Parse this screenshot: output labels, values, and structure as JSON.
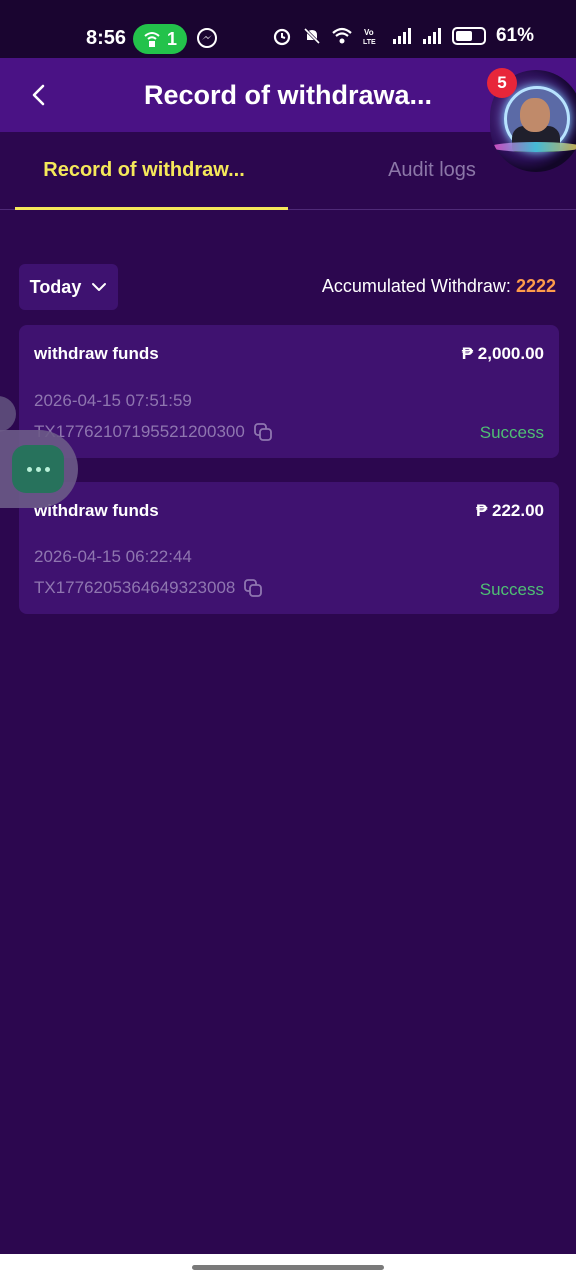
{
  "status_bar": {
    "time": "8:56",
    "hotspot_count": "1",
    "battery": "61%",
    "icons": [
      "alarm-icon",
      "mute-icon",
      "wifi-icon",
      "volte-icon",
      "signal-icon",
      "signal-icon",
      "battery-icon"
    ]
  },
  "header": {
    "title": "Record of withdrawa...",
    "back_icon": "chevron-left-icon"
  },
  "floating_avatar": {
    "badge": "5"
  },
  "tabs": [
    {
      "label": "Record of withdraw...",
      "active": true
    },
    {
      "label": "Audit logs",
      "active": false
    }
  ],
  "filter": {
    "date_label": "Today",
    "accum_label": "Accumulated Withdraw:",
    "accum_value": "2222"
  },
  "records": [
    {
      "title": "withdraw funds",
      "amount": "₱ 2,000.00",
      "datetime": "2026-04-15 07:51:59",
      "tx": "TX17762107195521200300",
      "status": "Success"
    },
    {
      "title": "withdraw funds",
      "amount": "₱ 222.00",
      "datetime": "2026-04-15 06:22:44",
      "tx": "TX17762053646493230​08",
      "status": "Success"
    }
  ],
  "colors": {
    "background": "#2c074f",
    "header": "#4a1285",
    "card": "#3f1270",
    "active_tab": "#f5e85a",
    "accent_value": "#ff9b4a",
    "success": "#4fbf74"
  }
}
